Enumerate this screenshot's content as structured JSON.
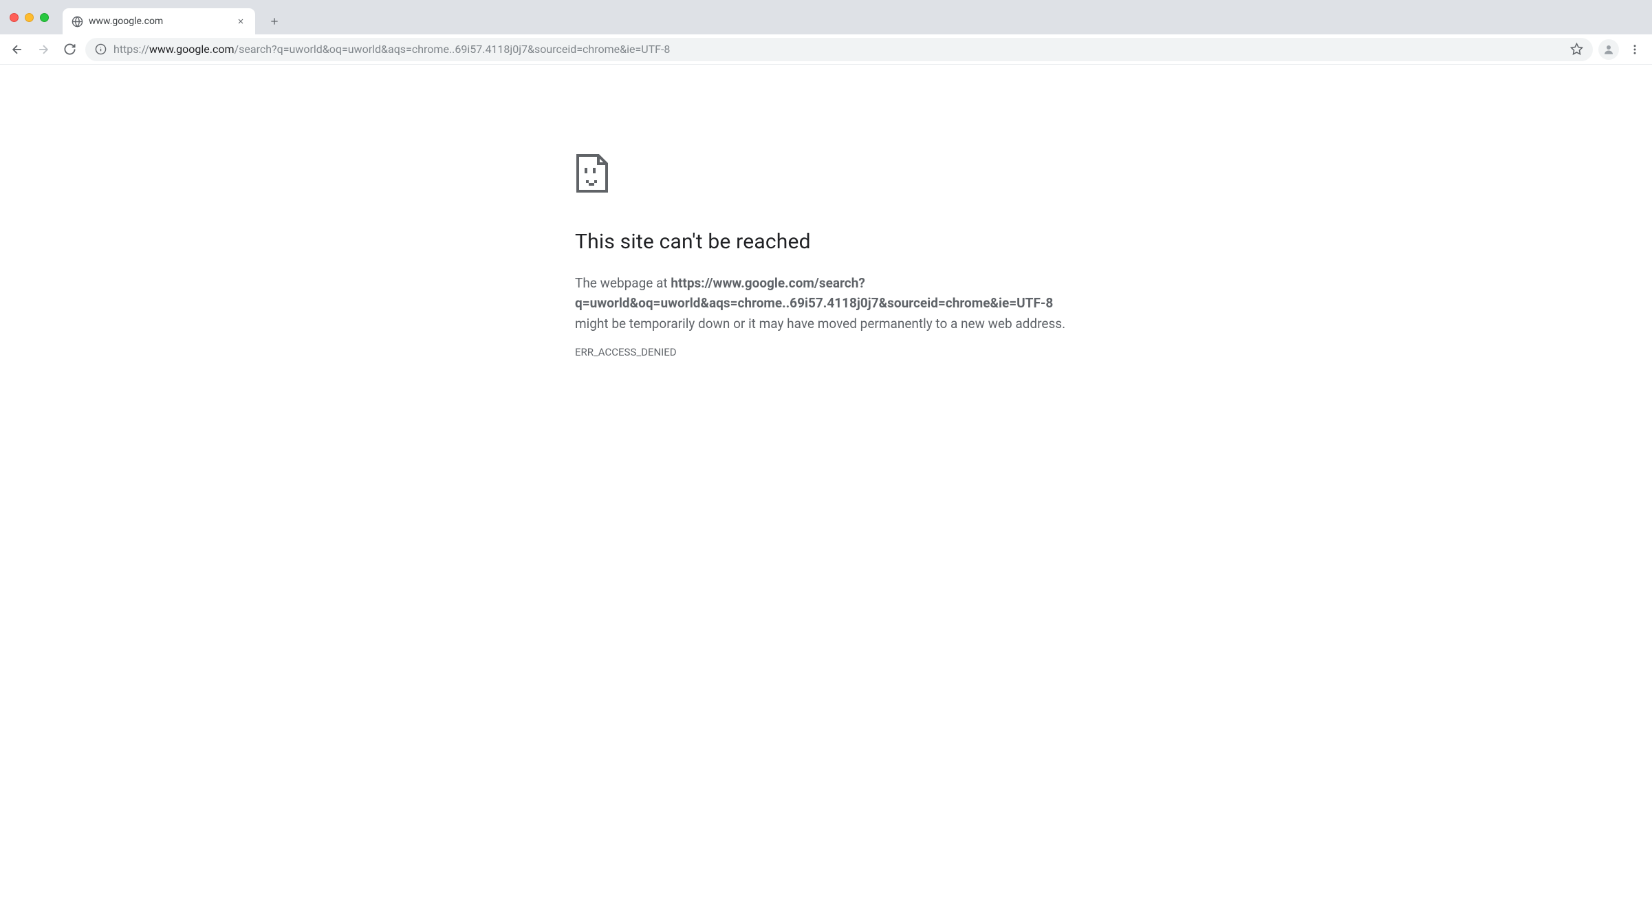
{
  "window": {
    "tab_title": "www.google.com"
  },
  "toolbar": {
    "url_scheme": "https://",
    "url_host": "www.google.com",
    "url_path": "/search?q=uworld&oq=uworld&aqs=chrome..69i57.4118j0j7&sourceid=chrome&ie=UTF-8"
  },
  "error": {
    "heading": "This site can't be reached",
    "desc_prefix": "The webpage at ",
    "desc_url": "https://www.google.com/search?q=uworld&oq=uworld&aqs=chrome..69i57.4118j0j7&sourceid=chrome&ie=UTF-8",
    "desc_suffix": " might be temporarily down or it may have moved permanently to a new web address.",
    "code": "ERR_ACCESS_DENIED"
  }
}
